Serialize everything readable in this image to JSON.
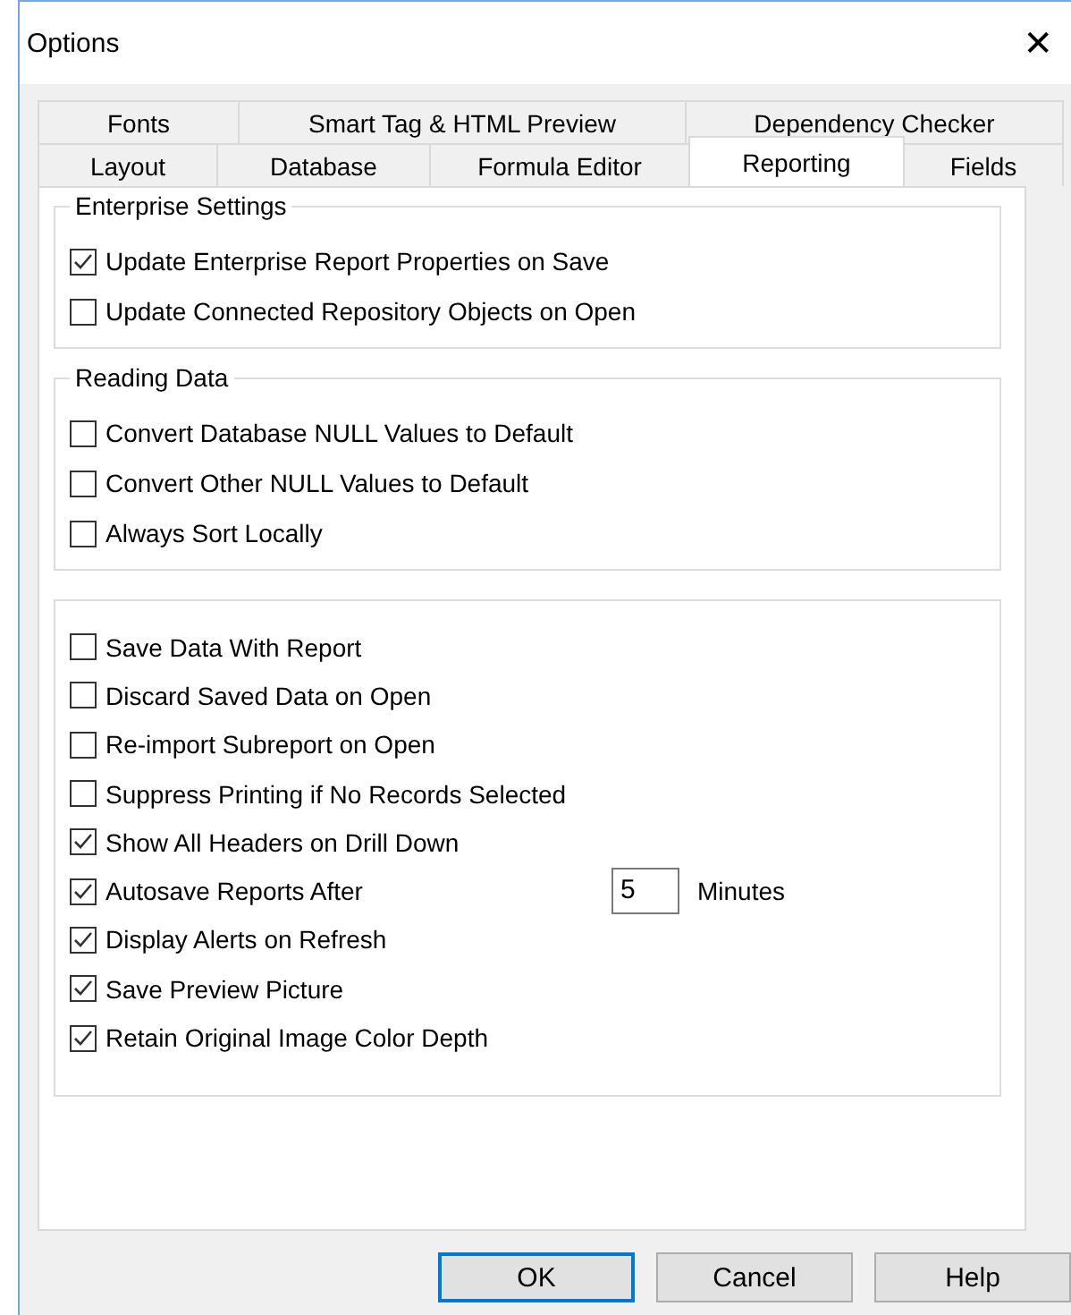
{
  "window": {
    "title": "Options",
    "close": "✕"
  },
  "tab_rows": [
    {
      "tabs": [
        {
          "label": "Fonts",
          "selected": false
        },
        {
          "label": "Smart Tag & HTML Preview",
          "selected": false
        },
        {
          "label": "Dependency Checker",
          "selected": false
        }
      ]
    },
    {
      "tabs": [
        {
          "label": "Layout",
          "selected": false
        },
        {
          "label": "Database",
          "selected": false
        },
        {
          "label": "Formula Editor",
          "selected": false
        },
        {
          "label": "Reporting",
          "selected": true
        },
        {
          "label": "Fields",
          "selected": false
        }
      ]
    }
  ],
  "groups": [
    {
      "title": "Enterprise Settings",
      "items": [
        {
          "kind": "checkbox",
          "label": "Update Enterprise Report Properties on Save",
          "checked": true
        },
        {
          "kind": "checkbox",
          "label": "Update Connected Repository Objects on Open",
          "checked": false
        }
      ]
    },
    {
      "title": "Reading Data",
      "items": [
        {
          "kind": "checkbox",
          "label": "Convert Database NULL Values to Default",
          "checked": false
        },
        {
          "kind": "checkbox",
          "label": "Convert Other NULL Values to Default",
          "checked": false
        },
        {
          "kind": "checkbox",
          "label": "Always Sort Locally",
          "checked": false
        }
      ]
    },
    {
      "items": [
        {
          "kind": "checkbox",
          "label": "Save Data With Report",
          "checked": false
        },
        {
          "kind": "checkbox",
          "label": "Discard Saved Data on Open",
          "checked": false
        },
        {
          "kind": "checkbox",
          "label": "Re-import Subreport on Open",
          "checked": false
        },
        {
          "kind": "checkbox",
          "label": "Suppress Printing if No Records Selected",
          "checked": false
        },
        {
          "kind": "checkbox",
          "label": "Show All Headers on Drill Down",
          "checked": true
        },
        {
          "kind": "checkbox-field",
          "label": "Autosave Reports After",
          "checked": true,
          "value": "5",
          "unit": "Minutes"
        },
        {
          "kind": "checkbox",
          "label": "Display Alerts on Refresh",
          "checked": true
        },
        {
          "kind": "checkbox",
          "label": "Save Preview Picture",
          "checked": true
        },
        {
          "kind": "checkbox",
          "label": "Retain Original Image Color Depth",
          "checked": true
        }
      ]
    }
  ],
  "buttons": [
    {
      "label": "OK",
      "default": true
    },
    {
      "label": "Cancel",
      "default": false
    },
    {
      "label": "Help",
      "default": false
    }
  ]
}
